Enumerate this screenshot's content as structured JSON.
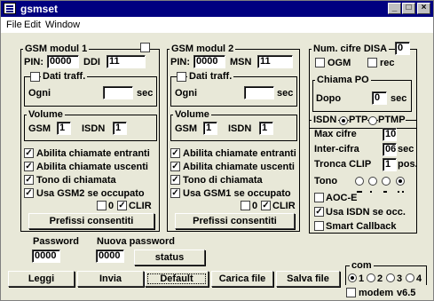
{
  "window": {
    "title": "gsmset"
  },
  "menu": [
    "File",
    "Edit",
    "Window"
  ],
  "gsm1": {
    "title": "GSM modul 1",
    "pin_label": "PIN:",
    "pin": "0000",
    "id_label": "DDI",
    "id_value": "11",
    "traffic_label": "Dati traff.",
    "ogni_label": "Ogni",
    "ogni_value": "",
    "sec_label": "sec",
    "volume_label": "Volume",
    "gsm_label": "GSM",
    "gsm_vol": "1",
    "isdn_label": "ISDN",
    "isdn_vol": "1",
    "options": [
      {
        "label": "Abilita chiamate entranti",
        "checked": true
      },
      {
        "label": "Abilita chiamate uscenti",
        "checked": true
      },
      {
        "label": "Tono di chiamata",
        "checked": true
      },
      {
        "label": "Usa GSM2 se occupato",
        "checked": true
      }
    ],
    "zero_label": "0",
    "clir_label": "CLIR",
    "prefix_button": "Prefissi consentiti"
  },
  "gsm2": {
    "title": "GSM modul 2",
    "pin_label": "PIN:",
    "pin": "0000",
    "id_label": "MSN",
    "id_value": "11",
    "traffic_label": "Dati traff.",
    "ogni_label": "Ogni",
    "ogni_value": "",
    "sec_label": "sec",
    "volume_label": "Volume",
    "gsm_label": "GSM",
    "gsm_vol": "1",
    "isdn_label": "ISDN",
    "isdn_vol": "1",
    "options": [
      {
        "label": "Abilita chiamate entranti",
        "checked": true
      },
      {
        "label": "Abilita chiamate uscenti",
        "checked": true
      },
      {
        "label": "Tono di chiamata",
        "checked": true
      },
      {
        "label": "Usa GSM1 se occupato",
        "checked": true
      }
    ],
    "zero_label": "0",
    "clir_label": "CLIR",
    "prefix_button": "Prefissi consentiti"
  },
  "disa": {
    "label": "Num. cifre DISA",
    "value": "0",
    "ogm_label": "OGM",
    "rec_label": "rec"
  },
  "chiama": {
    "title": "Chiama PO",
    "dopo_label": "Dopo",
    "value": "0",
    "sec_label": "sec"
  },
  "isdn": {
    "label": "ISDN",
    "ptp_label": "PTP",
    "ptmp_label": "PTMP",
    "max_cifre_label": "Max cifre",
    "max_cifre": "10",
    "inter_cifra_label": "Inter-cifra",
    "inter_cifra": "06",
    "inter_unit": "sec",
    "tronca_label": "Tronca CLIP",
    "tronca": "1",
    "tronca_unit": "pos.",
    "tono_label": "Tono",
    "aoce_label": "AOC-E",
    "usa_isdn_label": "Usa ISDN se occ.",
    "smart_label": "Smart Callback"
  },
  "password": {
    "label": "Password",
    "value": "0000",
    "new_label": "Nuova password",
    "new_value": "0000",
    "status_button": "status"
  },
  "buttons": {
    "leggi": "Leggi",
    "invia": "Invia",
    "default": "Default",
    "carica": "Carica file",
    "salva": "Salva file"
  },
  "com": {
    "label": "com",
    "ports": [
      "1",
      "2",
      "3",
      "4"
    ],
    "selected": "1",
    "modem_label": "modem",
    "version": "v6.5"
  }
}
